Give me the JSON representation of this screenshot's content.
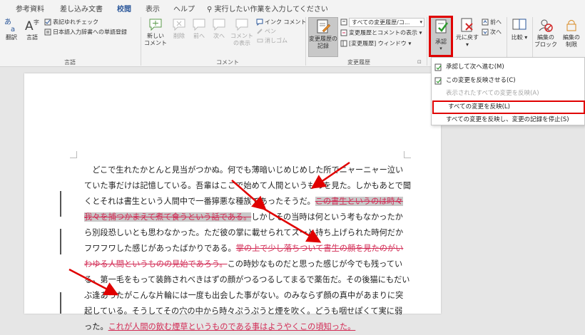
{
  "tabs": [
    "参考資料",
    "差し込み文書",
    "校閲",
    "表示",
    "ヘルプ"
  ],
  "active_tab": "校閲",
  "search": {
    "text": "実行したい作業を入力してください"
  },
  "ribbon": {
    "proofing": {
      "spelling": "翻訳",
      "language": "言語",
      "check1": "表記ゆれチェック",
      "check2": "日本語入力辞書への単語登録",
      "label": "言語"
    },
    "comments": {
      "new": "新しい\nコメント",
      "delete": "削除",
      "prev": "前へ",
      "next": "次へ",
      "show": "コメント\nの表示",
      "ink": "インク コメント",
      "pen": "ペン",
      "eraser": "消しゴム",
      "label": "コメント"
    },
    "tracking": {
      "track": "変更履歴の\n記録",
      "markup": "すべての変更履歴/コ...",
      "show_markup": "変更履歴とコメントの表示",
      "pane": "[変更履歴] ウィンドウ",
      "label": "変更履歴"
    },
    "changes": {
      "accept": "承認",
      "reject": "元に戻す",
      "prev": "前へ",
      "next": "次へ"
    },
    "compare": {
      "label": "比較"
    },
    "protect": {
      "block": "編集の\nブロック",
      "restrict": "編集の\n制限"
    }
  },
  "accept_menu": [
    {
      "label": "承認して次へ進む(M)",
      "enabled": true,
      "highlight": false
    },
    {
      "label": "この変更を反映させる(C)",
      "enabled": true,
      "highlight": false
    },
    {
      "label": "表示されたすべての変更を反映(A)",
      "enabled": false,
      "highlight": false
    },
    {
      "label": "すべての変更を反映(L)",
      "enabled": true,
      "highlight": true
    },
    {
      "label": "すべての変更を反映し、変更の記録を停止(S)",
      "enabled": true,
      "highlight": false
    }
  ],
  "document": {
    "lines": [
      [
        {
          "t": "　どこで生れたかとんと見当がつかぬ。何でも薄暗いじめじめした所でニャーニャー泣い",
          "s": "n"
        }
      ],
      [
        {
          "t": "ていた事だけは記憶している。吾輩はここで始めて人間というものを見た。しかもあとで聞",
          "s": "n"
        }
      ],
      [
        {
          "t": "くとそれは書生という人間中で一番獰悪な種族であったそうだ。",
          "s": "n"
        },
        {
          "t": "この書生というのは時々",
          "s": "dh"
        }
      ],
      [
        {
          "t": "我々を捕つかまえて煮て食うという話である。",
          "s": "dh"
        },
        {
          "t": "しかしその当時は何という考もなかったか",
          "s": "n"
        }
      ],
      [
        {
          "t": "ら別段恐しいとも思わなかった。ただ彼の掌に載せられてスーと持ち上げられた時何だか",
          "s": "n"
        }
      ],
      [
        {
          "t": "フワフワした感じがあったばかりである。",
          "s": "n"
        },
        {
          "t": "掌の上で少し落ちついて書生の顔を見たのがい",
          "s": "d"
        }
      ],
      [
        {
          "t": "わゆる人間というものの見始であろう。",
          "s": "d"
        },
        {
          "t": "この時妙なものだと思った感じが今でも残ってい",
          "s": "n"
        }
      ],
      [
        {
          "t": "る。第一毛をもって装飾されべきはずの顔がつるつるしてまるで薬缶だ。その後猫にもだい",
          "s": "n"
        }
      ],
      [
        {
          "t": "ぶ逢あったがこんな片輪には一度も出会した事がない。のみならず顔の真中があまりに突",
          "s": "n"
        }
      ],
      [
        {
          "t": "起している。そうしてその穴の中から時々ぷうぷうと煙を吹く。どうも咽せぽくて実に弱",
          "s": "n"
        }
      ],
      [
        {
          "t": "った。",
          "s": "n"
        },
        {
          "t": "これが人間の飲む煙草というものである事はようやくこの頃知った。",
          "s": "i"
        }
      ]
    ]
  },
  "colors": {
    "accent": "#2b579a",
    "revision": "#d22a54",
    "callout": "#e00000"
  }
}
